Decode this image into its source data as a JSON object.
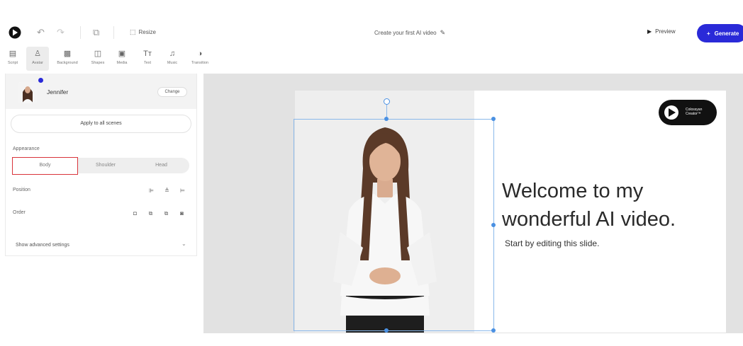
{
  "topbar": {
    "resize_label": "Resize",
    "project_title": "Create your first AI video",
    "preview_label": "Preview",
    "generate_label": "Generate"
  },
  "toolbar": {
    "tools": [
      {
        "label": "Script",
        "icon": "script-icon"
      },
      {
        "label": "Avatar",
        "icon": "avatar-icon"
      },
      {
        "label": "Background",
        "icon": "background-icon"
      },
      {
        "label": "Shapes",
        "icon": "shapes-icon"
      },
      {
        "label": "Media",
        "icon": "media-icon"
      },
      {
        "label": "Text",
        "icon": "text-icon"
      },
      {
        "label": "Music",
        "icon": "music-icon"
      },
      {
        "label": "Transition",
        "icon": "transition-icon"
      }
    ]
  },
  "panel": {
    "avatar_name": "Jennifer",
    "change_label": "Change",
    "apply_label": "Apply to all scenes",
    "appearance_label": "Appearance",
    "appearance_options": [
      "Body",
      "Shoulder",
      "Head"
    ],
    "appearance_selected": "Body",
    "position_label": "Position",
    "order_label": "Order",
    "advanced_label": "Show advanced settings"
  },
  "slide": {
    "headline": "Welcome to my wonderful AI video.",
    "subline": "Start by editing this slide.",
    "brand_line1": "Colossyan",
    "brand_line2": "Creator™"
  },
  "colors": {
    "accent": "#2a2ad8",
    "selection": "#4a90e2",
    "highlight": "#d9343b"
  }
}
